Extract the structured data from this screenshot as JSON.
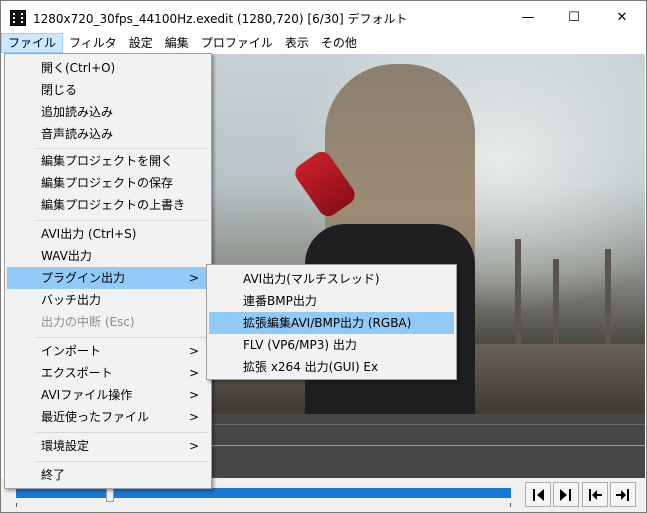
{
  "window": {
    "title": "1280x720_30fps_44100Hz.exedit (1280,720)  [6/30]  デフォルト",
    "minimize_glyph": "—",
    "maximize_glyph": "☐",
    "close_glyph": "✕"
  },
  "menubar": [
    "ファイル",
    "フィルタ",
    "設定",
    "編集",
    "プロファイル",
    "表示",
    "その他"
  ],
  "file_menu": {
    "items": [
      {
        "label": "開く(Ctrl+O)"
      },
      {
        "label": "閉じる"
      },
      {
        "label": "追加読み込み"
      },
      {
        "label": "音声読み込み"
      },
      {
        "label": "編集プロジェクトを開く"
      },
      {
        "label": "編集プロジェクトの保存"
      },
      {
        "label": "編集プロジェクトの上書き"
      },
      {
        "label": "AVI出力 (Ctrl+S)"
      },
      {
        "label": "WAV出力"
      },
      {
        "label": "プラグイン出力"
      },
      {
        "label": "バッチ出力"
      },
      {
        "label": "出力の中断 (Esc)"
      },
      {
        "label": "インポート"
      },
      {
        "label": "エクスポート"
      },
      {
        "label": "AVIファイル操作"
      },
      {
        "label": "最近使ったファイル"
      },
      {
        "label": "環境設定"
      },
      {
        "label": "終了"
      }
    ],
    "submenu_arrow": ">"
  },
  "plugin_submenu": {
    "items": [
      {
        "label": "AVI出力(マルチスレッド)"
      },
      {
        "label": "連番BMP出力"
      },
      {
        "label": "拡張編集AVI/BMP出力 (RGBA)"
      },
      {
        "label": "FLV (VP6/MP3) 出力"
      },
      {
        "label": "拡張 x264 出力(GUI) Ex"
      }
    ]
  },
  "playback": {
    "seek_position": 0.19,
    "buttons": [
      "prev-frame",
      "next-frame",
      "go-start",
      "go-end"
    ]
  },
  "colors": {
    "menu_highlight": "#91c9f7",
    "seekbar": "#1779d6",
    "timeline_bg": "#474747",
    "timeline_cursor": "#4fd14f"
  }
}
